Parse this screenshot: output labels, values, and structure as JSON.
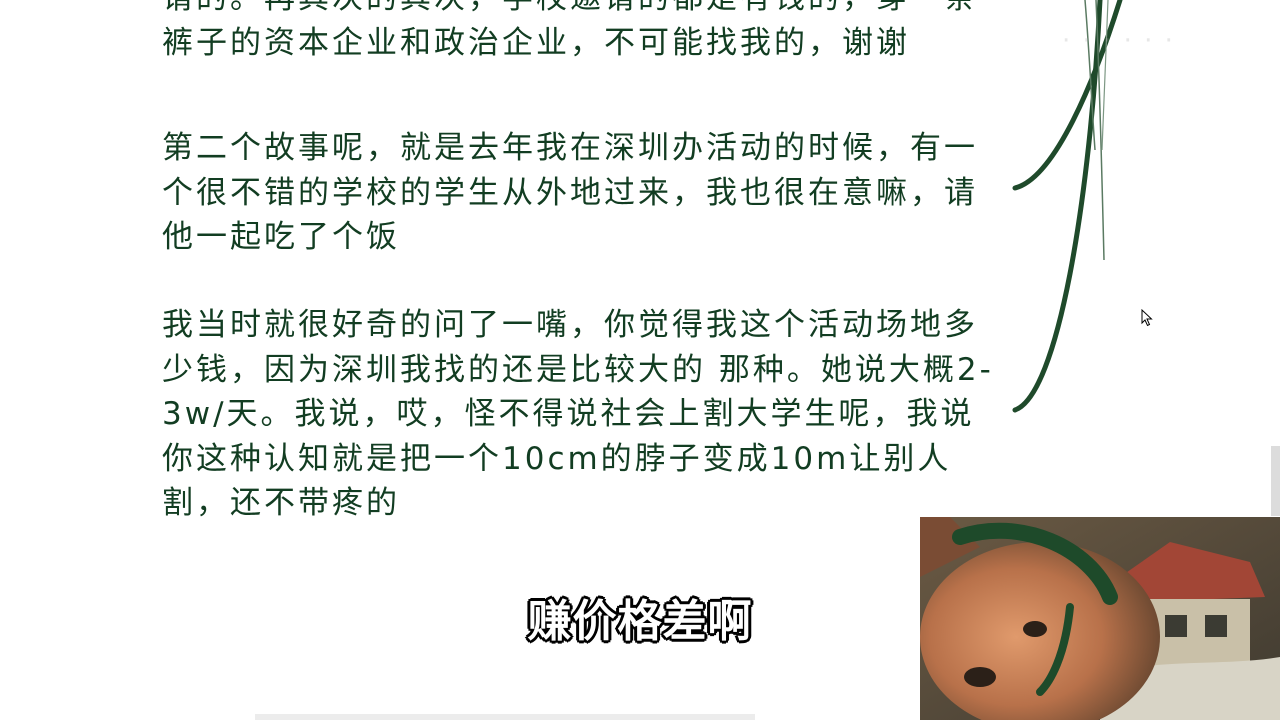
{
  "document": {
    "paragraphs": [
      "请的。再其次的其次，学校邀请的都是有钱的，穿一条裤子的资本企业和政治企业，不可能找我的，谢谢",
      "第二个故事呢，就是去年我在深圳办活动的时候，有一个很不错的学校的学生从外地过来，我也很在意嘛，请他一起吃了个饭",
      "我当时就很好奇的问了一嘴，你觉得我这个活动场地多少钱，因为深圳我找的还是比较大的 那种。她说大概2-3w/天。我说，哎，怪不得说社会上割大学生呢，我说你这种认知就是把一个10cm的脖子变成10m让别人割，还不带疼的"
    ]
  },
  "subtitle": {
    "text": "赚价格差啊"
  },
  "colors": {
    "text": "#123d22",
    "accent_curve": "#1f4a2b",
    "subtitle_fill": "#ffffff",
    "subtitle_outline": "#000000"
  },
  "icons": {
    "cursor": "arrow-cursor-icon"
  }
}
